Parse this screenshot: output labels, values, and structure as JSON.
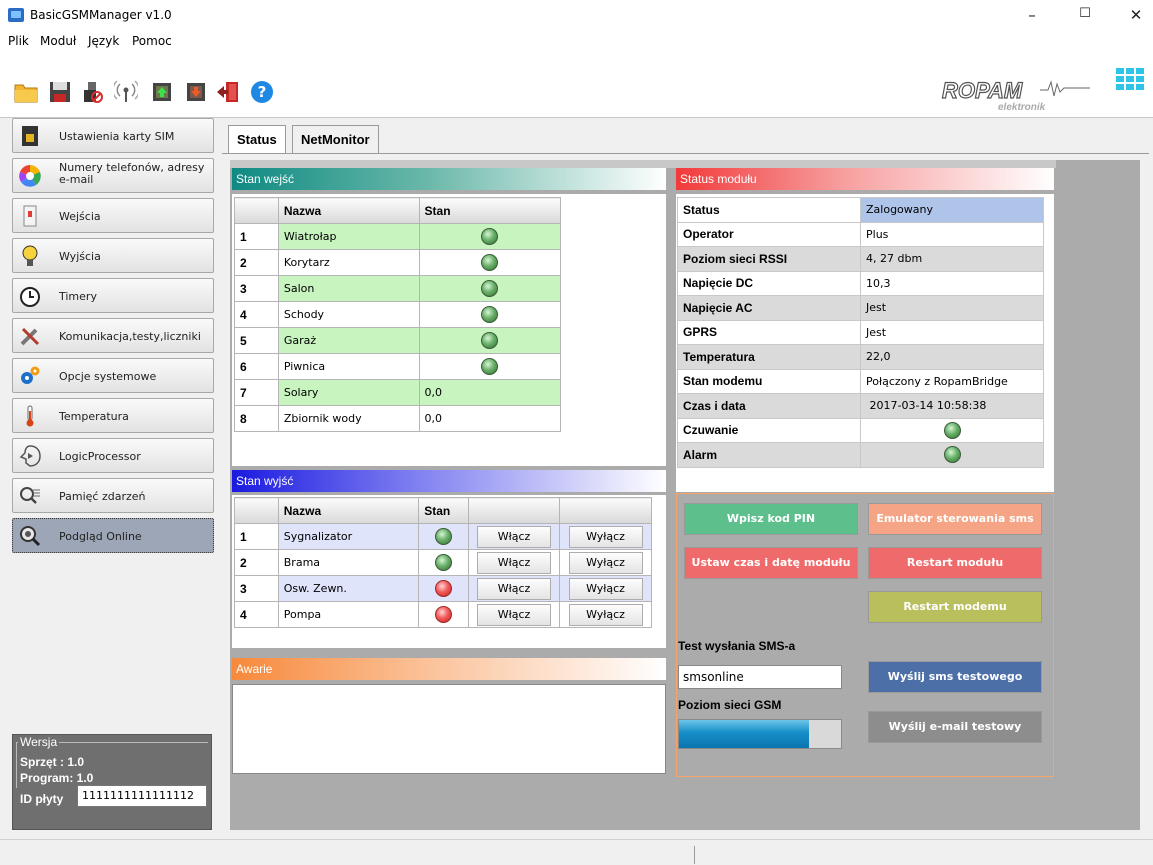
{
  "window": {
    "title": "BasicGSMManager v1.0"
  },
  "menu": [
    "Plik",
    "Moduł",
    "Język",
    "Pomoc"
  ],
  "toolbar_icons": [
    "open-folder-icon",
    "save-icon",
    "usb-disconnect-icon",
    "wireless-signal-icon",
    "chip-upload-icon",
    "chip-download-icon",
    "exit-door-icon",
    "help-icon"
  ],
  "logo": {
    "text": "ROPAM",
    "subtext": "elektronik"
  },
  "sidebar": {
    "items": [
      {
        "label": "Ustawienia karty SIM",
        "icon": "sim-card-icon"
      },
      {
        "label": "Numery telefonów, adresy",
        "label2": "e-mail",
        "icon": "color-wheel-icon"
      },
      {
        "label": "Wejścia",
        "icon": "input-icon"
      },
      {
        "label": "Wyjścia",
        "icon": "light-bulb-icon"
      },
      {
        "label": "Timery",
        "icon": "clock-icon"
      },
      {
        "label": "Komunikacja,testy,liczniki",
        "icon": "tools-icon"
      },
      {
        "label": "Opcje systemowe",
        "icon": "gears-icon"
      },
      {
        "label": "Temperatura",
        "icon": "thermometer-icon"
      },
      {
        "label": "LogicProcessor",
        "icon": "logic-icon"
      },
      {
        "label": "Pamięć zdarzeń",
        "icon": "event-log-icon"
      },
      {
        "label": "Podgląd Online",
        "icon": "magnifier-icon"
      }
    ],
    "active_index": 10
  },
  "version": {
    "legend": "Wersja",
    "hardware": "Sprzęt : 1.0",
    "program": "Program: 1.0",
    "id_label": "ID płyty",
    "id_value": "1111111111111112"
  },
  "tabs": [
    "Status",
    "NetMonitor"
  ],
  "inputs": {
    "header": "Stan wejść",
    "columns": [
      "Nazwa",
      "Stan"
    ],
    "rows": [
      {
        "n": "1",
        "name": "Wiatrołap",
        "state": "led-green"
      },
      {
        "n": "2",
        "name": "Korytarz",
        "state": "led-green"
      },
      {
        "n": "3",
        "name": "Salon",
        "state": "led-green"
      },
      {
        "n": "4",
        "name": "Schody",
        "state": "led-green"
      },
      {
        "n": "5",
        "name": "Garaż",
        "state": "led-green"
      },
      {
        "n": "6",
        "name": "Piwnica",
        "state": "led-green"
      },
      {
        "n": "7",
        "name": "Solary",
        "state": "0,0"
      },
      {
        "n": "8",
        "name": "Zbiornik wody",
        "state": "0,0"
      }
    ]
  },
  "outputs": {
    "header": "Stan wyjść",
    "columns": [
      "Nazwa",
      "Stan"
    ],
    "on_label": "Włącz",
    "off_label": "Wyłącz",
    "rows": [
      {
        "n": "1",
        "name": "Sygnalizator",
        "state": "green"
      },
      {
        "n": "2",
        "name": "Brama",
        "state": "green"
      },
      {
        "n": "3",
        "name": "Osw. Zewn.",
        "state": "red"
      },
      {
        "n": "4",
        "name": "Pompa",
        "state": "red"
      }
    ]
  },
  "faults": {
    "header": "Awarie"
  },
  "module_status": {
    "header": "Status modułu",
    "rows": [
      {
        "k": "Status",
        "v": "Zalogowany"
      },
      {
        "k": "Operator",
        "v": "Plus"
      },
      {
        "k": "Poziom sieci RSSI",
        "v": "4, 27 dbm"
      },
      {
        "k": "Napięcie DC",
        "v": "10,3"
      },
      {
        "k": "Napięcie AC",
        "v": "Jest"
      },
      {
        "k": "GPRS",
        "v": "Jest"
      },
      {
        "k": "Temperatura",
        "v": "22,0"
      },
      {
        "k": "Stan modemu",
        "v": "Połączony z RopamBridge"
      },
      {
        "k": "Czas i data",
        "v": " 2017-03-14 10:58:38"
      },
      {
        "k": "Czuwanie",
        "v": ""
      },
      {
        "k": "Alarm",
        "v": ""
      }
    ]
  },
  "actions": {
    "pin": "Wpisz kod PIN",
    "emulator": "Emulator sterowania sms",
    "set_time": "Ustaw czas i datę modułu",
    "restart_module": "Restart modułu",
    "restart_modem": "Restart modemu",
    "sms_test_label": "Test wysłania SMS-a",
    "sms_test_value": "smsonline",
    "send_sms": "Wyślij sms testowego",
    "gsm_level_label": "Poziom sieci GSM",
    "gsm_level_fraction": 0.8,
    "send_email": "Wyślij e-mail testowy"
  },
  "colors": {
    "inputs_header": "#0f8a83",
    "outputs_header": "#1a1ae0",
    "faults_header": "#f7893b",
    "status_header": "#f23a3a",
    "btn_green": "#5cbf8c",
    "btn_salmon": "#f5a585",
    "btn_red": "#ef6b6b",
    "btn_olive": "#b9bf5d",
    "btn_blue": "#4c6fa8",
    "btn_gray": "#8d8d8d"
  }
}
